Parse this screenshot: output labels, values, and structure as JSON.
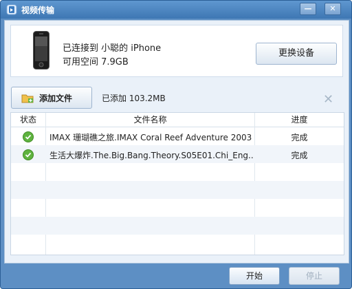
{
  "window": {
    "title": "视频传输",
    "minimize_label": "—",
    "close_label": "✕"
  },
  "device": {
    "name": "已连接到 小聪的 iPhone",
    "space": "可用空间 7.9GB",
    "change_button": "更换设备"
  },
  "toolbar": {
    "add_button": "添加文件",
    "added_text": "已添加 103.2MB",
    "clear_icon": "✕"
  },
  "table": {
    "headers": {
      "status": "状态",
      "name": "文件名称",
      "progress": "进度"
    },
    "rows": [
      {
        "status_icon": "check-circle-icon",
        "name": "IMAX 珊瑚礁之旅.IMAX Coral Reef Adventure 2003 ...",
        "progress": "完成"
      },
      {
        "status_icon": "check-circle-icon",
        "name": "生活大爆炸.The.Big.Bang.Theory.S05E01.Chi_Eng....",
        "progress": "完成"
      }
    ]
  },
  "footer": {
    "start_button": "开始",
    "stop_button": "停止"
  },
  "colors": {
    "titlebar": "#3e77b3",
    "accent": "#5fb33f"
  }
}
